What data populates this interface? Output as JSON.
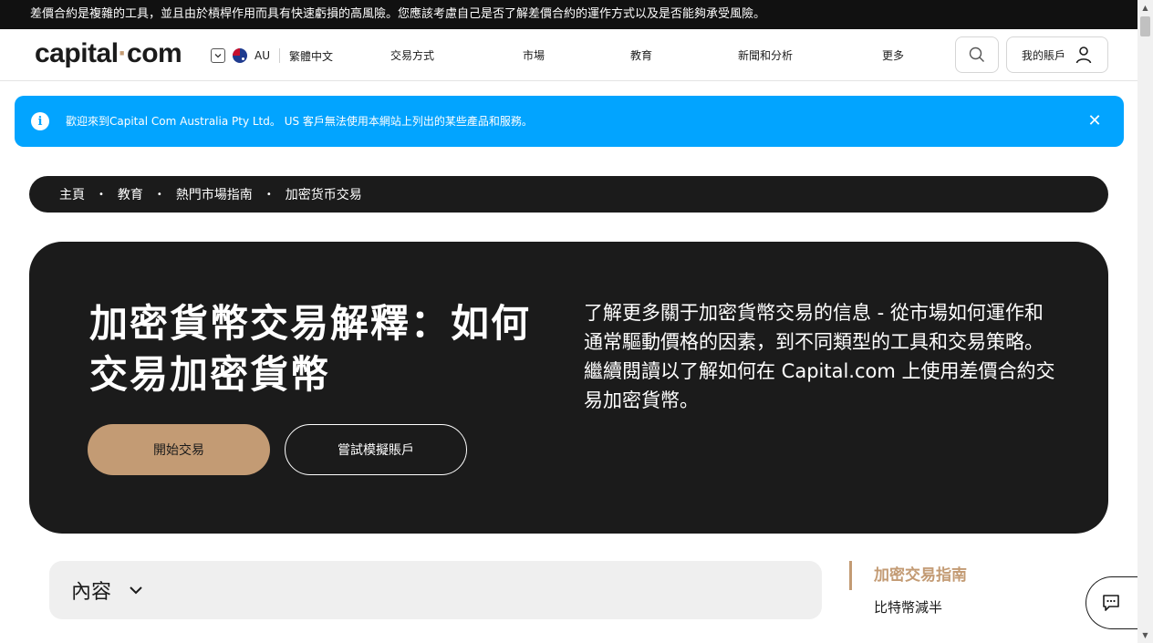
{
  "risk_banner": "差價合約是複雜的工具，並且由於槓桿作用而具有快速虧損的高風險。您應該考慮自己是否了解差價合約的運作方式以及是否能夠承受風險。",
  "header": {
    "logo_left": "capital",
    "logo_dot": "·",
    "logo_right": "com",
    "region": "AU",
    "language": "繁體中文",
    "nav": [
      "交易方式",
      "市場",
      "教育",
      "新聞和分析",
      "更多"
    ],
    "account_label": "我的賬戶"
  },
  "notice": {
    "icon_glyph": "i",
    "text": "歡迎來到Capital Com Australia Pty Ltd。 US 客戶無法使用本網站上列出的某些產品和服務。",
    "close_glyph": "✕"
  },
  "breadcrumb": {
    "items": [
      "主頁",
      "教育",
      "熱門市場指南",
      "加密货币交易"
    ],
    "separator": "•"
  },
  "hero": {
    "title": "加密貨幣交易解釋：如何交易加密貨幣",
    "description": "了解更多關于加密貨幣交易的信息 - 從市場如何運作和通常驅動價格的因素，到不同類型的工具和交易策略。繼續閱讀以了解如何在 Capital.com 上使用差價合約交易加密貨幣。",
    "primary_button": "開始交易",
    "secondary_button": "嘗試模擬賬戶"
  },
  "toc": {
    "label": "內容"
  },
  "side_nav": {
    "active": "加密交易指南",
    "items": [
      "比特幣減半"
    ]
  },
  "colors": {
    "accent": "#c39b74",
    "notice_bg": "#02a4ff",
    "dark": "#1b1b1b"
  },
  "icons": [
    "chevron-down-icon",
    "australia-flag-icon",
    "search-icon",
    "user-icon",
    "info-icon",
    "close-icon",
    "chat-icon"
  ]
}
